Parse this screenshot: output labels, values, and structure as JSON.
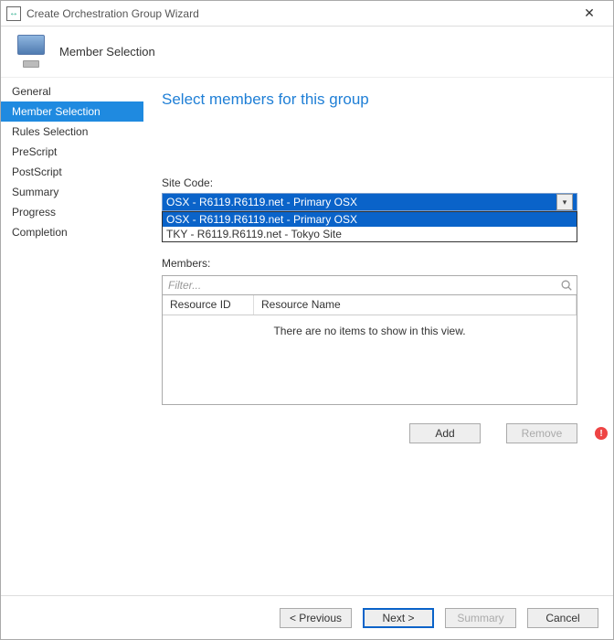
{
  "window": {
    "title": "Create Orchestration Group Wizard",
    "close_glyph": "✕"
  },
  "header": {
    "heading": "Member Selection"
  },
  "sidebar": {
    "items": [
      {
        "label": "General"
      },
      {
        "label": "Member Selection"
      },
      {
        "label": "Rules Selection"
      },
      {
        "label": "PreScript"
      },
      {
        "label": "PostScript"
      },
      {
        "label": "Summary"
      },
      {
        "label": "Progress"
      },
      {
        "label": "Completion"
      }
    ],
    "active_index": 1
  },
  "content": {
    "section_title": "Select members for this group",
    "site_code_label": "Site Code:",
    "site_code_selected": "OSX - R6119.R6119.net - Primary OSX",
    "site_code_options": [
      "OSX - R6119.R6119.net - Primary OSX",
      "TKY - R6119.R6119.net - Tokyo Site"
    ],
    "members_label": "Members:",
    "filter_placeholder": "Filter...",
    "columns": {
      "c1": "Resource ID",
      "c2": "Resource Name"
    },
    "empty_message": "There are no items to show in this view.",
    "add_label": "Add",
    "remove_label": "Remove",
    "error_glyph": "!"
  },
  "footer": {
    "previous": "< Previous",
    "next": "Next >",
    "summary": "Summary",
    "cancel": "Cancel"
  },
  "icons": {
    "app_glyph": "↔"
  }
}
